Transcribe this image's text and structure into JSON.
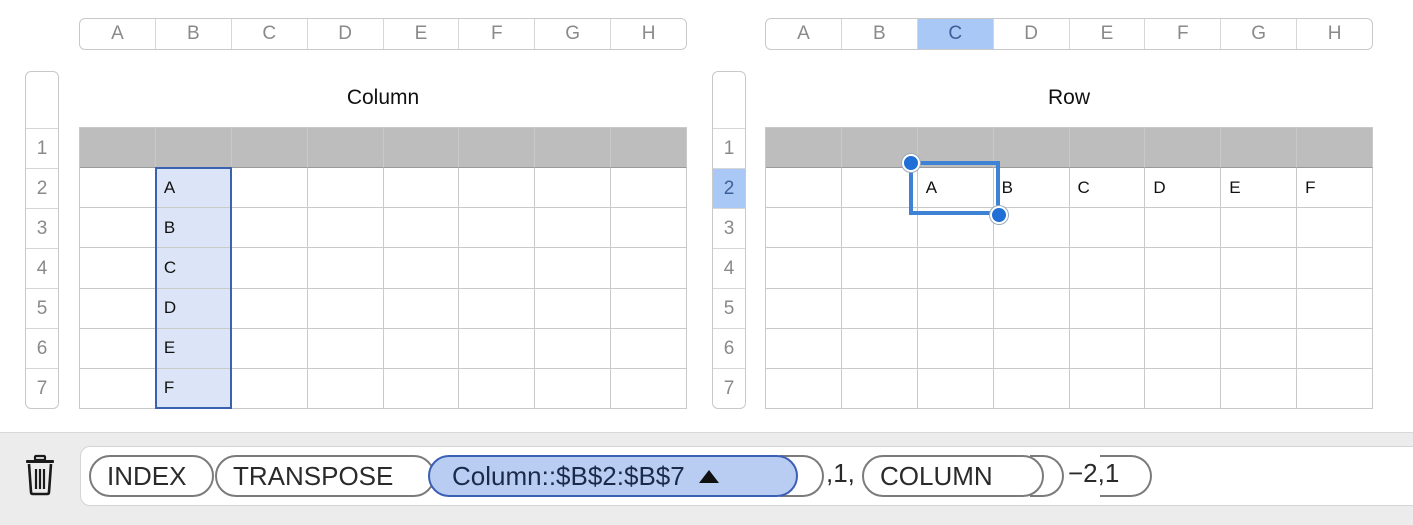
{
  "column_table": {
    "title": "Column",
    "col_headers": [
      "A",
      "B",
      "C",
      "D",
      "E",
      "F",
      "G",
      "H"
    ],
    "row_headers": [
      "1",
      "2",
      "3",
      "4",
      "5",
      "6",
      "7"
    ],
    "values": [
      "A",
      "B",
      "C",
      "D",
      "E",
      "F"
    ]
  },
  "row_table": {
    "title": "Row",
    "col_headers": [
      "A",
      "B",
      "C",
      "D",
      "E",
      "F",
      "G",
      "H"
    ],
    "selected_col": "C",
    "row_headers": [
      "1",
      "2",
      "3",
      "4",
      "5",
      "6",
      "7"
    ],
    "selected_row": "2",
    "values": [
      "A",
      "B",
      "C",
      "D",
      "E",
      "F"
    ]
  },
  "formula": {
    "fn_index": "INDEX",
    "fn_transpose": "TRANSPOSE",
    "reference": "Column::$B$2:$B$7",
    "args_after_transpose": ",1,",
    "fn_column": "COLUMN",
    "args_after_column": "−2,1"
  },
  "icons": {
    "trash": "trash-icon",
    "dropdown": "triangle-up-icon"
  },
  "colors": {
    "selection": "#a9c8f5",
    "reference_token": "#b9cdf3",
    "highlight_cells": "#dce5f8",
    "cell_handle": "#1f6fd6"
  }
}
